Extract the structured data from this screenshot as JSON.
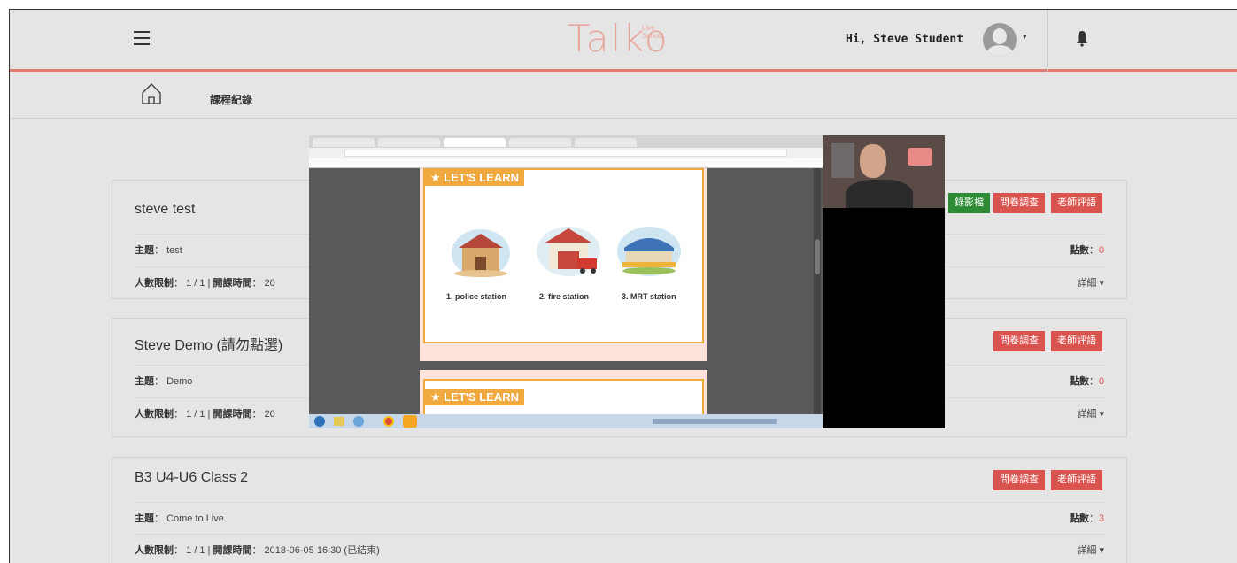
{
  "header": {
    "logo_text": "Talko",
    "logo_sub": "Live School",
    "greeting": "Hi, Steve Student",
    "caret": "▾"
  },
  "subheader": {
    "title": "課程紀錄"
  },
  "labels": {
    "topic": "主題",
    "limit": "人數限制",
    "time": "開課時間",
    "points": "點數",
    "details": "詳細",
    "colon": "："
  },
  "buttons": {
    "video": "錄影檔",
    "survey": "問卷調查",
    "review": "老師評語"
  },
  "courses": [
    {
      "title": "steve test",
      "topic": "test",
      "limit": "1 / 1",
      "time": "20",
      "points": "0"
    },
    {
      "title": "Steve Demo (請勿點選)",
      "topic": "Demo",
      "limit": "1 / 1",
      "time": "20",
      "points": "0"
    },
    {
      "title": "B3 U4-U6 Class 2",
      "topic": "Come to Live",
      "limit": "1 / 1",
      "time": "2018-06-05 16:30 (已結束)",
      "points": "3"
    }
  ],
  "video_overlay": {
    "slide_tag": "★ LET'S LEARN",
    "items": [
      "1. police station",
      "2. fire station",
      "3. MRT station"
    ]
  }
}
